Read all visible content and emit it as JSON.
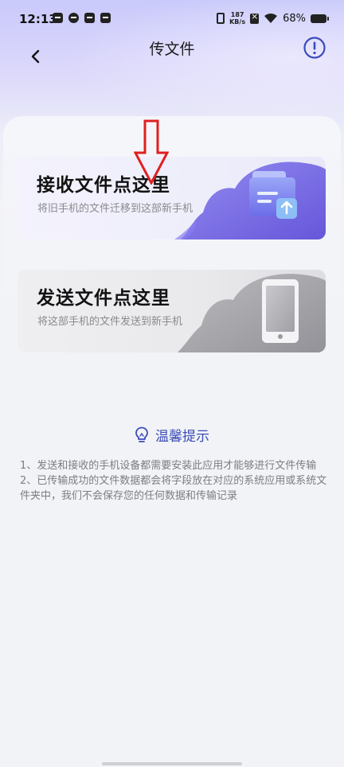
{
  "status_bar": {
    "time": "12:13",
    "net_speed_value": "187",
    "net_speed_unit": "KB/s",
    "battery": "68%"
  },
  "header": {
    "title": "传文件"
  },
  "cards": {
    "receive": {
      "title": "接收文件点这里",
      "description": "将旧手机的文件迁移到这部新手机"
    },
    "send": {
      "title": "发送文件点这里",
      "description": "将这部手机的文件发送到新手机"
    }
  },
  "tips": {
    "title": "温馨提示",
    "items": [
      "1、发送和接收的手机设备都需要安装此应用才能够进行文件传输",
      "2、已传输成功的文件数据都会将字段放在对应的系统应用或系统文件夹中，我们不会保存您的任何数据和传输记录"
    ]
  },
  "colors": {
    "accent": "#3b4cb8",
    "arrow": "#e02020",
    "header_gradient_top": "#c9c9fb"
  },
  "icons": [
    "back-icon",
    "info-icon",
    "lightbulb-icon",
    "folder-upload-icon",
    "phone-icon",
    "wifi-icon",
    "battery-icon"
  ]
}
